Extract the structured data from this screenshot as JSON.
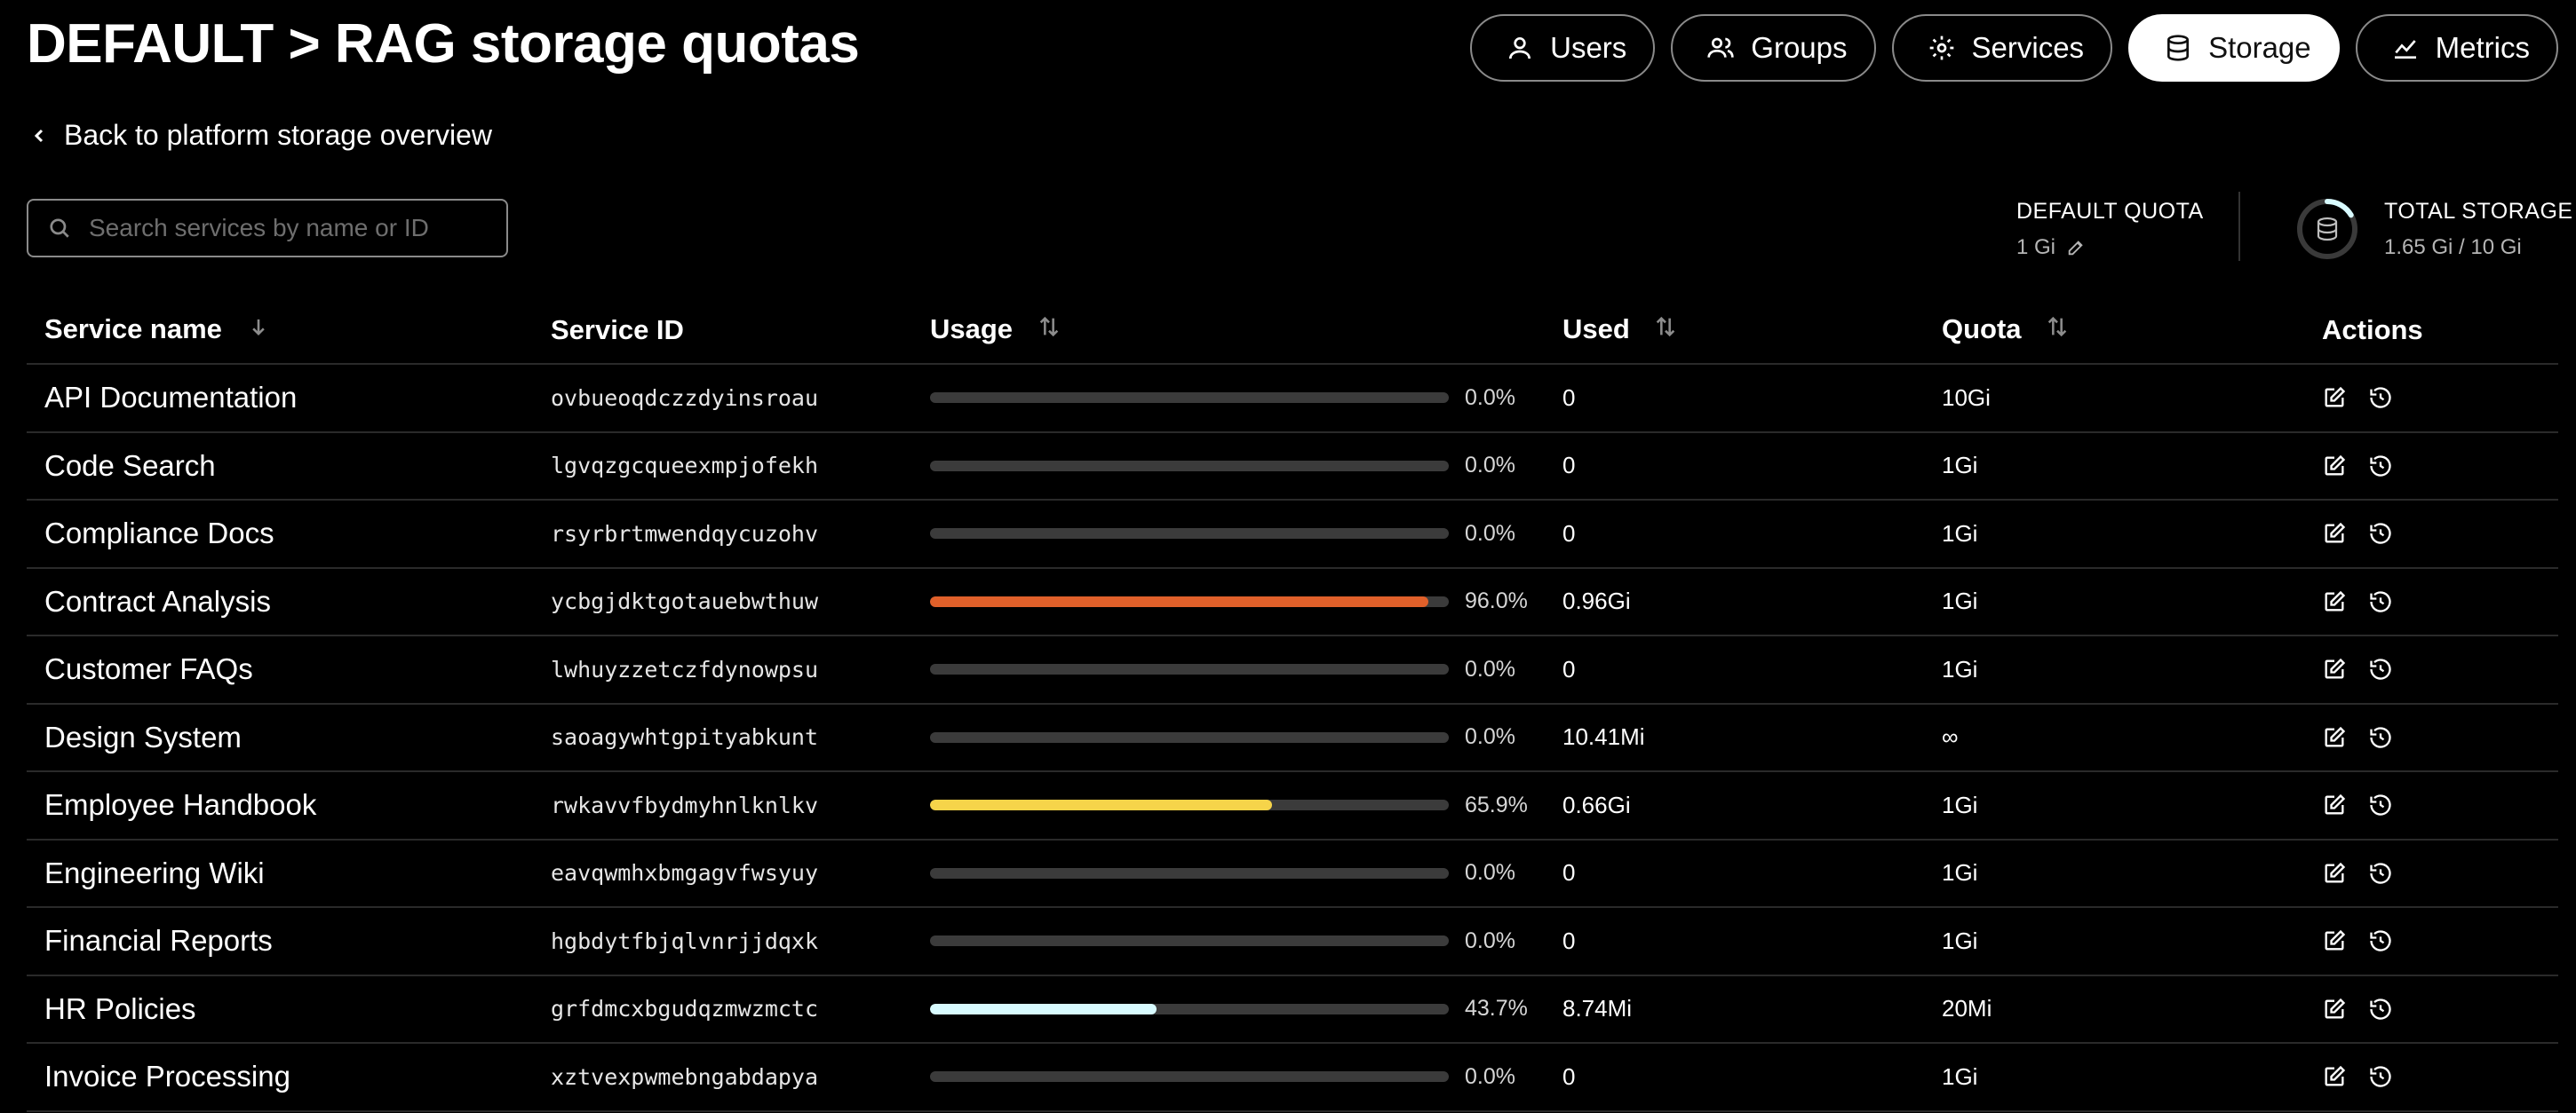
{
  "header": {
    "title": "DEFAULT > RAG storage quotas",
    "nav": [
      {
        "label": "Users",
        "icon": "user-icon",
        "active": false
      },
      {
        "label": "Groups",
        "icon": "users-icon",
        "active": false
      },
      {
        "label": "Services",
        "icon": "gear-icon",
        "active": false
      },
      {
        "label": "Storage",
        "icon": "database-icon",
        "active": true
      },
      {
        "label": "Metrics",
        "icon": "chart-icon",
        "active": false
      }
    ]
  },
  "back_link": "Back to platform storage overview",
  "search": {
    "placeholder": "Search services by name or ID",
    "value": ""
  },
  "stats": {
    "default_quota_label": "DEFAULT QUOTA",
    "default_quota_value": "1 Gi",
    "total_storage_label": "TOTAL STORAGE",
    "total_storage_value": "1.65 Gi / 10 Gi",
    "total_storage_fraction": 0.165
  },
  "table": {
    "headers": {
      "name": "Service name",
      "id": "Service ID",
      "usage": "Usage",
      "used": "Used",
      "quota": "Quota",
      "actions": "Actions"
    },
    "rows": [
      {
        "name": "API Documentation",
        "id": "ovbueoqdczzdyinsroau",
        "usage": 0.0,
        "usage_label": "0.0%",
        "used": "0",
        "quota": "10Gi",
        "color": "#3b3b3b"
      },
      {
        "name": "Code Search",
        "id": "lgvqzgcqueexmpjofekh",
        "usage": 0.0,
        "usage_label": "0.0%",
        "used": "0",
        "quota": "1Gi",
        "color": "#3b3b3b"
      },
      {
        "name": "Compliance Docs",
        "id": "rsyrbrtmwendqycuzohv",
        "usage": 0.0,
        "usage_label": "0.0%",
        "used": "0",
        "quota": "1Gi",
        "color": "#3b3b3b"
      },
      {
        "name": "Contract Analysis",
        "id": "ycbgjdktgotauebwthuw",
        "usage": 96.0,
        "usage_label": "96.0%",
        "used": "0.96Gi",
        "quota": "1Gi",
        "color": "#e0602a"
      },
      {
        "name": "Customer FAQs",
        "id": "lwhuyzzetczfdynowpsu",
        "usage": 0.0,
        "usage_label": "0.0%",
        "used": "0",
        "quota": "1Gi",
        "color": "#3b3b3b"
      },
      {
        "name": "Design System",
        "id": "saoagywhtgpityabkunt",
        "usage": 0.0,
        "usage_label": "0.0%",
        "used": "10.41Mi",
        "quota": "∞",
        "color": "#3b3b3b"
      },
      {
        "name": "Employee Handbook",
        "id": "rwkavvfbydmyhnlknlkv",
        "usage": 65.9,
        "usage_label": "65.9%",
        "used": "0.66Gi",
        "quota": "1Gi",
        "color": "#f6d44a"
      },
      {
        "name": "Engineering Wiki",
        "id": "eavqwmhxbmgagvfwsyuy",
        "usage": 0.0,
        "usage_label": "0.0%",
        "used": "0",
        "quota": "1Gi",
        "color": "#3b3b3b"
      },
      {
        "name": "Financial Reports",
        "id": "hgbdytfbjqlvnrjjdqxk",
        "usage": 0.0,
        "usage_label": "0.0%",
        "used": "0",
        "quota": "1Gi",
        "color": "#3b3b3b"
      },
      {
        "name": "HR Policies",
        "id": "grfdmcxbgudqzmwzmctc",
        "usage": 43.7,
        "usage_label": "43.7%",
        "used": "8.74Mi",
        "quota": "20Mi",
        "color": "#d8fbff"
      },
      {
        "name": "Invoice Processing",
        "id": "xztvexpwmebngabdapya",
        "usage": 0.0,
        "usage_label": "0.0%",
        "used": "0",
        "quota": "1Gi",
        "color": "#3b3b3b"
      }
    ]
  }
}
